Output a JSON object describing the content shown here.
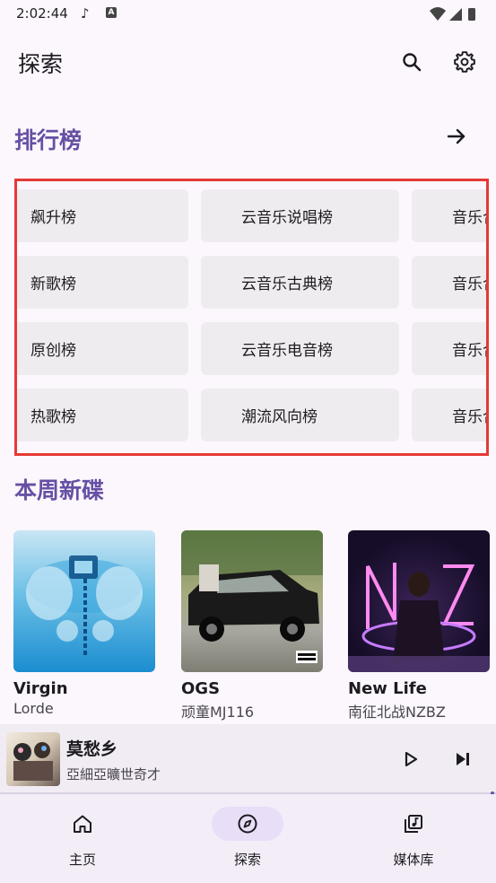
{
  "status": {
    "time": "2:02:44"
  },
  "app_bar": {
    "title": "探索"
  },
  "charts_section": {
    "title": "排行榜",
    "items": [
      [
        "飙升榜",
        "云音乐说唱榜",
        "音乐合"
      ],
      [
        "新歌榜",
        "云音乐古典榜",
        "音乐合"
      ],
      [
        "原创榜",
        "云音乐电音榜",
        "音乐合"
      ],
      [
        "热歌榜",
        "潮流风向榜",
        "音乐合"
      ]
    ]
  },
  "new_albums": {
    "title": "本周新碟",
    "albums": [
      {
        "title": "Virgin",
        "artist": "Lorde"
      },
      {
        "title": "OGS",
        "artist": "顽童MJ116"
      },
      {
        "title": "New Life",
        "artist": "南征北战NZBZ"
      }
    ]
  },
  "mini_player": {
    "title": "莫愁乡",
    "artist": "亞細亞曠世奇才"
  },
  "nav": {
    "home": "主页",
    "explore": "探索",
    "library": "媒体库"
  }
}
